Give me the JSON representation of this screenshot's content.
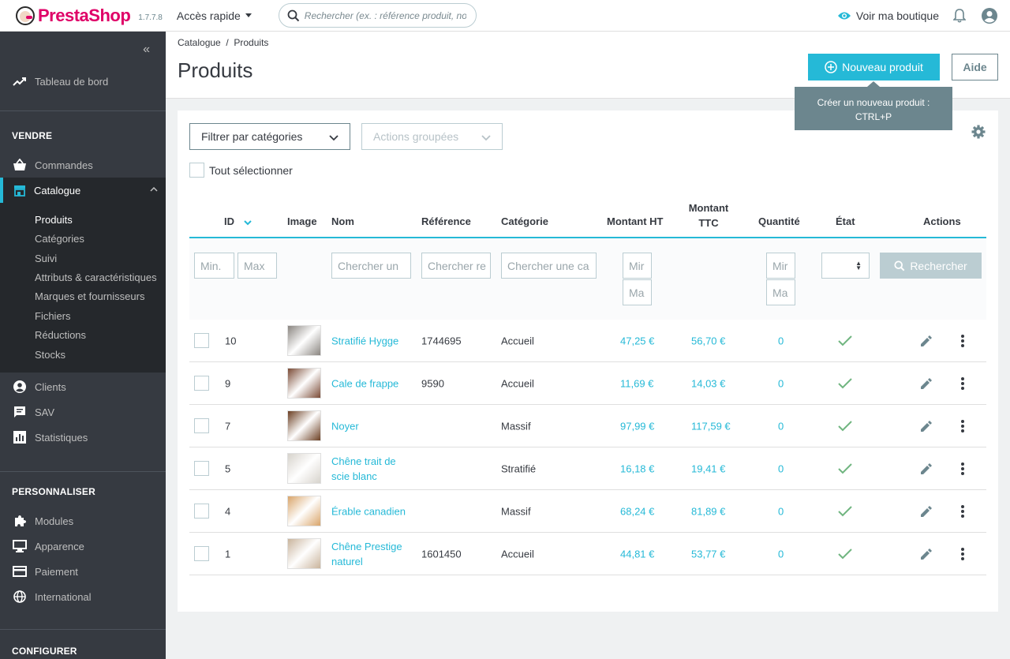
{
  "header": {
    "brand": "PrestaShop",
    "version": "1.7.7.8",
    "quick_access": "Accès rapide",
    "search_placeholder": "Rechercher (ex. : référence produit, nom",
    "view_shop": "Voir ma boutique"
  },
  "sidebar": {
    "collapse": "«",
    "dashboard": "Tableau de bord",
    "sections": {
      "sell": "VENDRE",
      "customize": "PERSONNALISER",
      "configure": "CONFIGURER"
    },
    "orders": "Commandes",
    "catalog": "Catalogue",
    "catalog_sub": [
      "Produits",
      "Catégories",
      "Suivi",
      "Attributs & caractéristiques",
      "Marques et fournisseurs",
      "Fichiers",
      "Réductions",
      "Stocks"
    ],
    "customers": "Clients",
    "service": "SAV",
    "stats": "Statistiques",
    "modules": "Modules",
    "appearance": "Apparence",
    "payment": "Paiement",
    "international": "International"
  },
  "page": {
    "breadcrumb": "Catalogue  /  Produits",
    "title": "Produits",
    "new_product": "Nouveau produit",
    "help": "Aide",
    "tooltip_line1": "Créer un nouveau produit :",
    "tooltip_line2": "CTRL+P"
  },
  "toolbar": {
    "filter_categories": "Filtrer par catégories",
    "bulk_actions": "Actions groupées",
    "select_all": "Tout sélectionner"
  },
  "table": {
    "headers": {
      "id": "ID",
      "image": "Image",
      "name": "Nom",
      "reference": "Référence",
      "category": "Catégorie",
      "price_ht": "Montant HT",
      "price_ttc_1": "Montant",
      "price_ttc_2": "TTC",
      "quantity": "Quantité",
      "state": "État",
      "actions": "Actions"
    },
    "filters": {
      "id_min": "Min.",
      "id_max": "Max",
      "name": "Chercher un",
      "reference": "Chercher re",
      "category": "Chercher une ca",
      "price_min": "Mir",
      "price_max": "Ma",
      "qty_min": "Mir",
      "qty_max": "Ma",
      "search_button": "Rechercher"
    },
    "rows": [
      {
        "id": "10",
        "name": "Stratifié Hygge",
        "name2": "",
        "reference": "1744695",
        "category": "Accueil",
        "price_ht": "47,25 €",
        "price_ttc": "56,70 €",
        "quantity": "0",
        "thumb_color": "#8a8580"
      },
      {
        "id": "9",
        "name": "Cale de frappe",
        "name2": "",
        "reference": "9590",
        "category": "Accueil",
        "price_ht": "11,69 €",
        "price_ttc": "14,03 €",
        "quantity": "0",
        "thumb_color": "#7a4a35"
      },
      {
        "id": "7",
        "name": "Noyer",
        "name2": "",
        "reference": "",
        "category": "Massif",
        "price_ht": "97,99 €",
        "price_ttc": "117,59 €",
        "quantity": "0",
        "thumb_color": "#6b3e22"
      },
      {
        "id": "5",
        "name": "Chêne trait de",
        "name2": "scie blanc",
        "reference": "",
        "category": "Stratifié",
        "price_ht": "16,18 €",
        "price_ttc": "19,41 €",
        "quantity": "0",
        "thumb_color": "#d7d3cc"
      },
      {
        "id": "4",
        "name": "Érable canadien",
        "name2": "",
        "reference": "",
        "category": "Massif",
        "price_ht": "68,24 €",
        "price_ttc": "81,89 €",
        "quantity": "0",
        "thumb_color": "#d9a56a"
      },
      {
        "id": "1",
        "name": "Chêne Prestige",
        "name2": "naturel",
        "reference": "1601450",
        "category": "Accueil",
        "price_ht": "44,81 €",
        "price_ttc": "53,77 €",
        "quantity": "0",
        "thumb_color": "#c9b49c"
      }
    ]
  },
  "colors": {
    "accent": "#25b9d7",
    "sidebar_bg": "#363a41",
    "brand": "#df0067",
    "success": "#70b580"
  }
}
